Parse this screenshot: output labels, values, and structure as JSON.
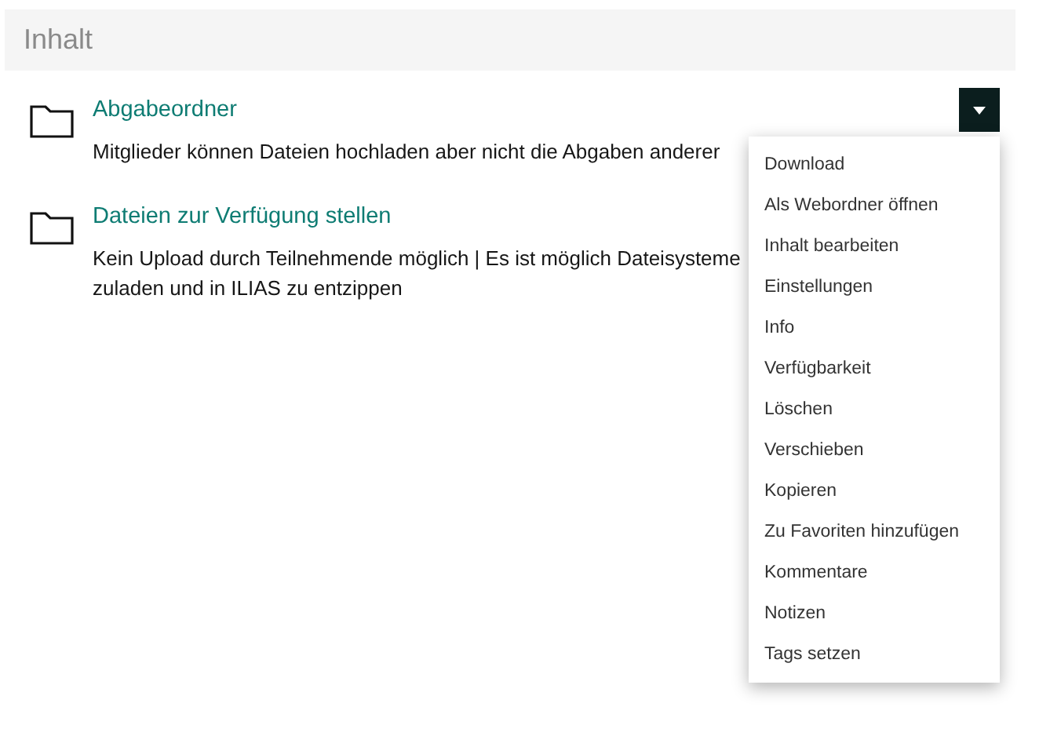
{
  "section": {
    "title": "Inhalt"
  },
  "items": [
    {
      "title": "Abgabeordner",
      "description": "Mitglieder können Dateien hochladen aber nicht die Abgaben anderer",
      "has_actions": true
    },
    {
      "title": "Dateien zur Verfügung stellen",
      "description": "Kein Upload durch Teilnehmende möglich | Es ist möglich Dateisysteme zuladen und in ILIAS zu entzippen",
      "has_actions": false
    }
  ],
  "actions_menu": {
    "expanded": true,
    "items": [
      "Download",
      "Als Webordner öffnen",
      "Inhalt bearbeiten",
      "Einstellungen",
      "Info",
      "Verfügbarkeit",
      "Löschen",
      "Verschieben",
      "Kopieren",
      "Zu Favoriten hinzufügen",
      "Kommentare",
      "Notizen",
      "Tags setzen"
    ]
  }
}
